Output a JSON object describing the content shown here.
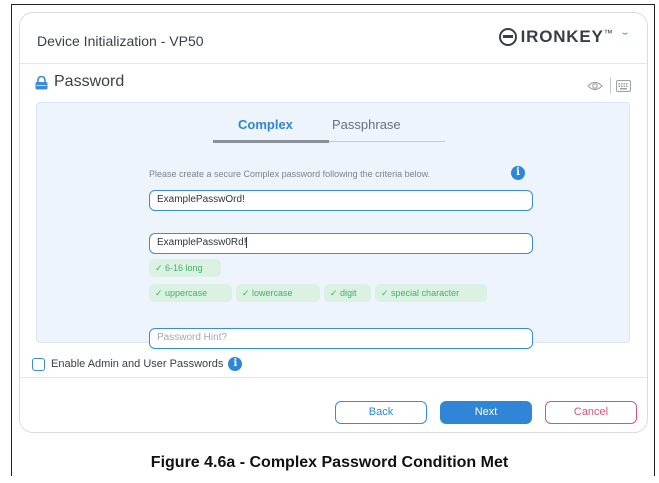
{
  "window": {
    "title": "Device Initialization - VP50",
    "brand_name": "IRONKEY",
    "brand_trademark": "™",
    "menu_glyph": "ˇ"
  },
  "section": {
    "title": "Password"
  },
  "tabs": [
    {
      "label": "Complex",
      "active": true
    },
    {
      "label": "Passphrase",
      "active": false
    }
  ],
  "form": {
    "instruction": "Please create a secure Complex password following the criteria below.",
    "password_value": "ExamplePasswOrd!",
    "confirm_value": "ExamplePassw0Rd!",
    "hint_placeholder": "Password Hint?"
  },
  "criteria": [
    {
      "label": "✓ 6-16 long",
      "met": true
    },
    {
      "label": "✓ uppercase",
      "met": true
    },
    {
      "label": "✓ lowercase",
      "met": true
    },
    {
      "label": "✓ digit",
      "met": true
    },
    {
      "label": "✓ special character",
      "met": true
    }
  ],
  "admin_option": {
    "label": "Enable Admin and User Passwords",
    "checked": false
  },
  "buttons": {
    "back": "Back",
    "next": "Next",
    "cancel": "Cancel"
  },
  "caption": "Figure 4.6a - Complex Password Condition Met",
  "icons": {
    "lock": "lock-icon",
    "eye": "eye-icon",
    "keyboard": "keyboard-icon",
    "info": "info-icon",
    "brand": "ironkey-logo-icon",
    "menu": "chevron-down-icon"
  },
  "colors": {
    "accent": "#2f86d6",
    "success_text": "#3fb06a",
    "success_bg": "#dbf2e3",
    "cancel": "#d4547e",
    "panel_bg": "#eef4fb",
    "lock": "#3b8bd6"
  }
}
